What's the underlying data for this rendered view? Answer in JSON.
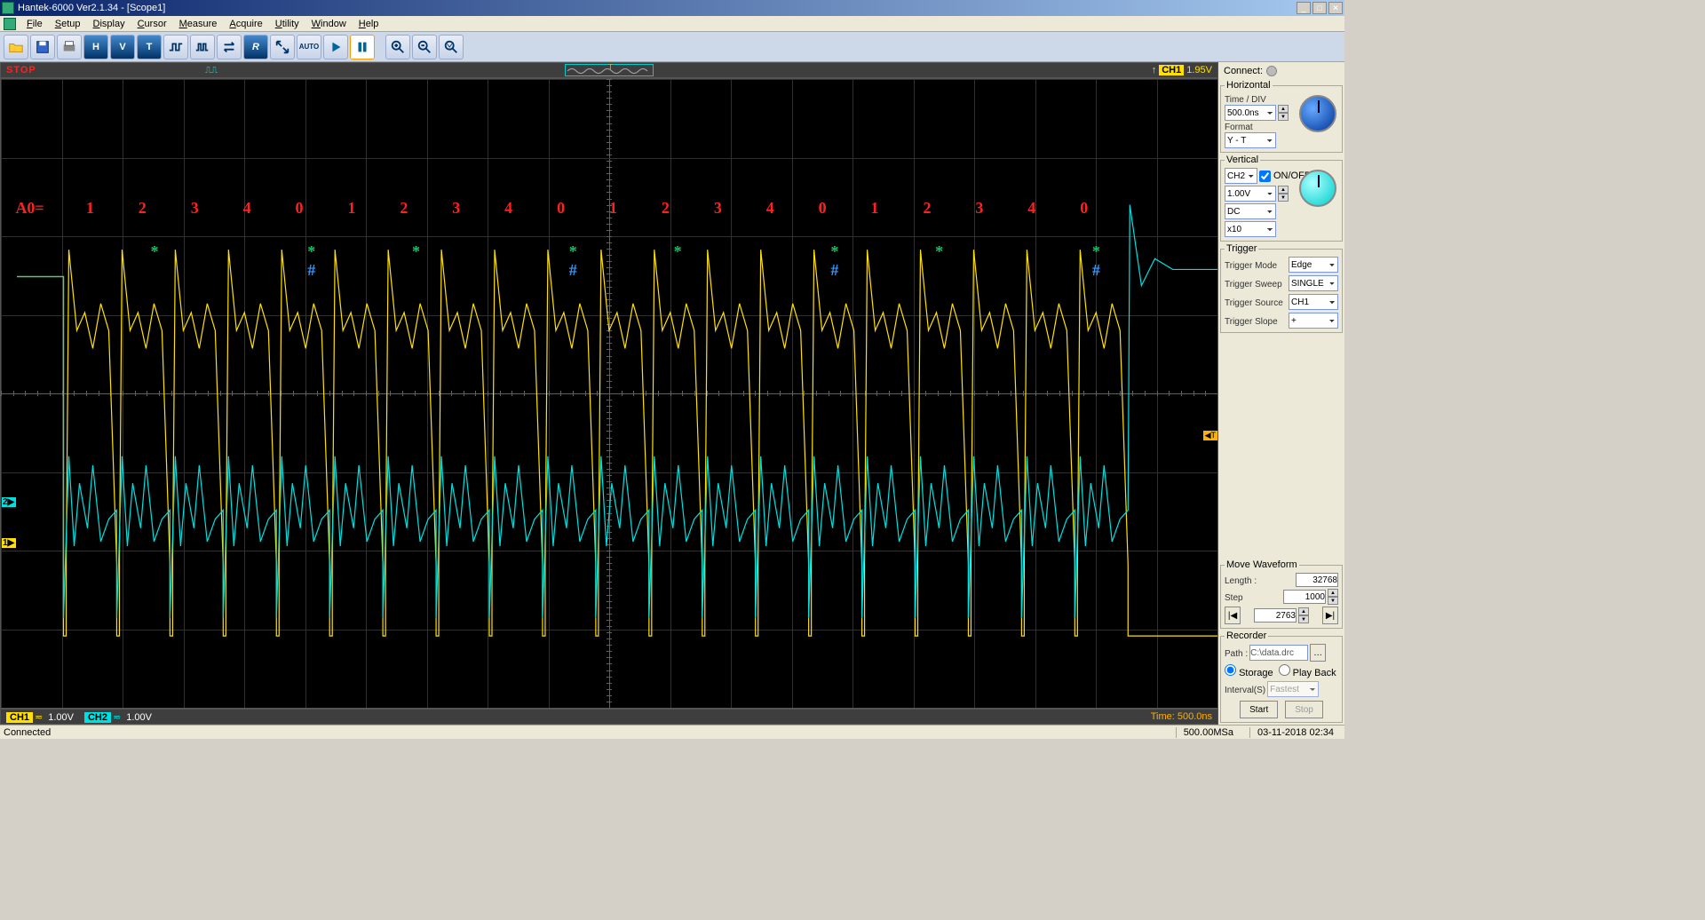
{
  "title": "Hantek-6000 Ver2.1.34 - [Scope1]",
  "menu": {
    "items": [
      "File",
      "Setup",
      "Display",
      "Cursor",
      "Measure",
      "Acquire",
      "Utility",
      "Window",
      "Help"
    ]
  },
  "toolbar": {
    "icons": [
      "open",
      "save",
      "print",
      "H",
      "V",
      "T",
      "pulse1",
      "pulse2",
      "swap",
      "R",
      "resize",
      "auto",
      "play",
      "pause",
      "zoomin",
      "zoomout",
      "zoomfit"
    ]
  },
  "topstrip": {
    "stop": "STOP",
    "trig_edge": "↑",
    "trig_ch": "CH1",
    "trig_level": "1.95V"
  },
  "botstrip": {
    "ch1": "CH1",
    "ch1v": "1.00V",
    "ch2": "CH2",
    "ch2v": "1.00V",
    "time": "Time: 500.0ns"
  },
  "side": {
    "connect": "Connect:",
    "horizontal": {
      "legend": "Horizontal",
      "tdiv_lbl": "Time / DIV",
      "tdiv": "500.0ns",
      "format_lbl": "Format",
      "format": "Y - T"
    },
    "vertical": {
      "legend": "Vertical",
      "ch": "CH2",
      "onoff": "ON/OFF",
      "vdiv": "1.00V",
      "coupling": "DC",
      "probe": "x10"
    },
    "trigger": {
      "legend": "Trigger",
      "mode_lbl": "Trigger Mode",
      "mode": "Edge",
      "sweep_lbl": "Trigger Sweep",
      "sweep": "SINGLE",
      "source_lbl": "Trigger Source",
      "source": "CH1",
      "slope_lbl": "Trigger Slope",
      "slope": "+"
    },
    "move": {
      "legend": "Move Waveform",
      "len_lbl": "Length :",
      "len": "32768",
      "step_lbl": "Step",
      "step": "1000",
      "pos": "2763"
    },
    "recorder": {
      "legend": "Recorder",
      "path_lbl": "Path :",
      "path": "C:\\data.drc",
      "storage": "Storage",
      "playback": "Play Back",
      "interval_lbl": "Interval(S)",
      "interval": "Fastest",
      "start": "Start",
      "stop": "Stop"
    }
  },
  "status": {
    "connected": "Connected",
    "rate": "500.00MSa",
    "datetime": "03-11-2018  02:34"
  },
  "annotations": {
    "a0": "A0=",
    "red_seq": [
      "1",
      "2",
      "3",
      "4",
      "0",
      "1",
      "2",
      "3",
      "4",
      "0",
      "1",
      "2",
      "3",
      "4",
      "0",
      "1",
      "2",
      "3",
      "4",
      "0"
    ],
    "green_star": "*",
    "blue_hash": "#"
  }
}
